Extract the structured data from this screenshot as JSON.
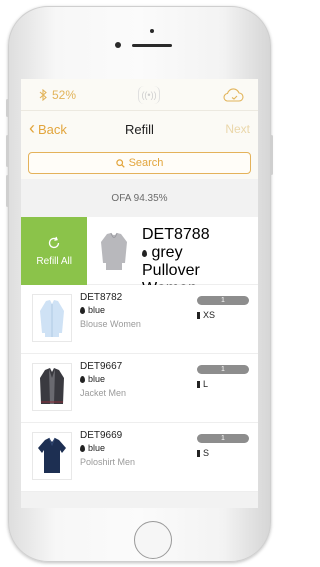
{
  "status": {
    "battery": "52%"
  },
  "nav": {
    "back": "Back",
    "title": "Refill",
    "next": "Next"
  },
  "search": {
    "label": "Search"
  },
  "ofa": "OFA 94.35%",
  "swiped_item": {
    "action_label": "Refill All",
    "article": "DET8788",
    "color": "grey",
    "category": "Pullover Women"
  },
  "items": [
    {
      "article": "DET8782",
      "color": "blue",
      "category": "Blouse Women",
      "count": "1",
      "size": "XS",
      "icon": "blouse-icon"
    },
    {
      "article": "DET9667",
      "color": "blue",
      "category": "Jacket Men",
      "count": "1",
      "size": "L",
      "icon": "jacket-icon"
    },
    {
      "article": "DET9669",
      "color": "blue",
      "category": "Poloshirt Men",
      "count": "1",
      "size": "S",
      "icon": "poloshirt-icon"
    }
  ],
  "colors": {
    "accent": "#e2a53c",
    "success": "#8bc34a",
    "pill": "#8d8d8d"
  }
}
